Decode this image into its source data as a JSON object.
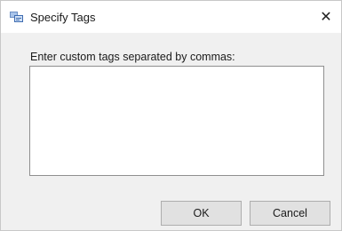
{
  "window": {
    "title": "Specify Tags",
    "close_glyph": "✕",
    "app_icon": "tag-dialog-icon"
  },
  "form": {
    "prompt": "Enter custom tags separated by commas:",
    "tags_value": ""
  },
  "buttons": {
    "ok_label": "OK",
    "cancel_label": "Cancel"
  },
  "colors": {
    "dialog_background": "#f0f0f0",
    "titlebar_background": "#ffffff",
    "button_background": "#e1e1e1",
    "input_border": "#8f8f8f"
  }
}
